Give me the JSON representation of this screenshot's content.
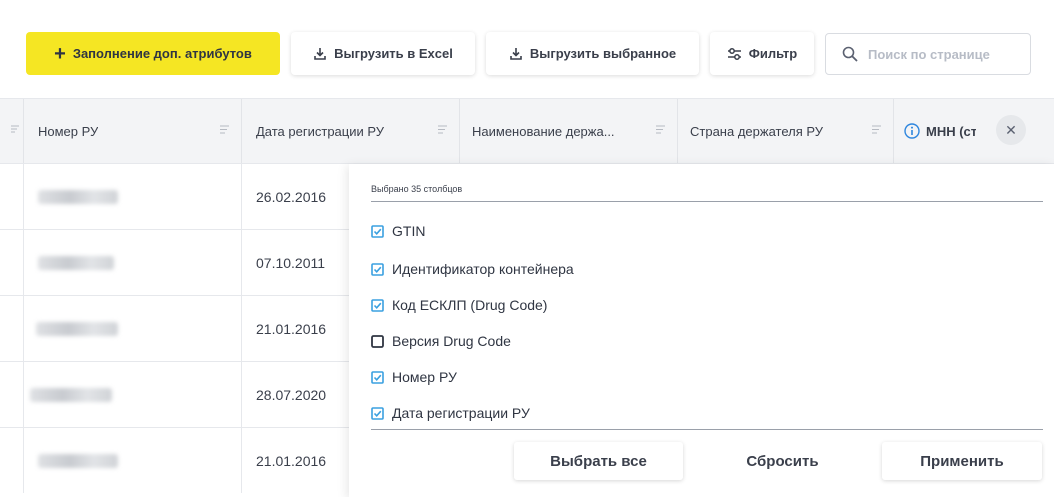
{
  "toolbar": {
    "fill_attributes_label": "Заполнение доп. атрибутов",
    "export_excel_label": "Выгрузить в Excel",
    "export_selected_label": "Выгрузить выбранное",
    "filter_label": "Фильтр",
    "search_placeholder": "Поиск по странице",
    "search_value": ""
  },
  "table": {
    "columns": [
      {
        "label": "Номер РУ"
      },
      {
        "label": "Дата регистрации РУ"
      },
      {
        "label": "Наименование держа..."
      },
      {
        "label": "Страна держателя РУ"
      },
      {
        "label": "МНН (ст"
      }
    ],
    "rows": [
      {
        "date": "26.02.2016"
      },
      {
        "date": "07.10.2011"
      },
      {
        "date": "21.01.2016"
      },
      {
        "date": "28.07.2020"
      },
      {
        "date": "21.01.2016"
      }
    ]
  },
  "popup": {
    "selected_count_text": "Выбрано 35 столбцов",
    "options": [
      {
        "label": "GTIN",
        "checked": true
      },
      {
        "label": "Идентификатор контейнера",
        "checked": true
      },
      {
        "label": "Код ЕСКЛП (Drug Code)",
        "checked": true
      },
      {
        "label": "Версия Drug Code",
        "checked": false
      },
      {
        "label": "Номер РУ",
        "checked": true
      },
      {
        "label": "Дата регистрации РУ",
        "checked": true
      }
    ],
    "select_all_label": "Выбрать все",
    "reset_label": "Сбросить",
    "apply_label": "Применить"
  },
  "icons": {
    "download": "download-icon",
    "filter": "filter-sliders-icon",
    "search": "search-icon",
    "column_menu": "column-menu-icon",
    "info": "info-icon",
    "close": "close-icon"
  },
  "colors": {
    "accent_yellow": "#f5e623",
    "checkbox_blue": "#3aa0e0",
    "info_blue": "#2e86de"
  }
}
